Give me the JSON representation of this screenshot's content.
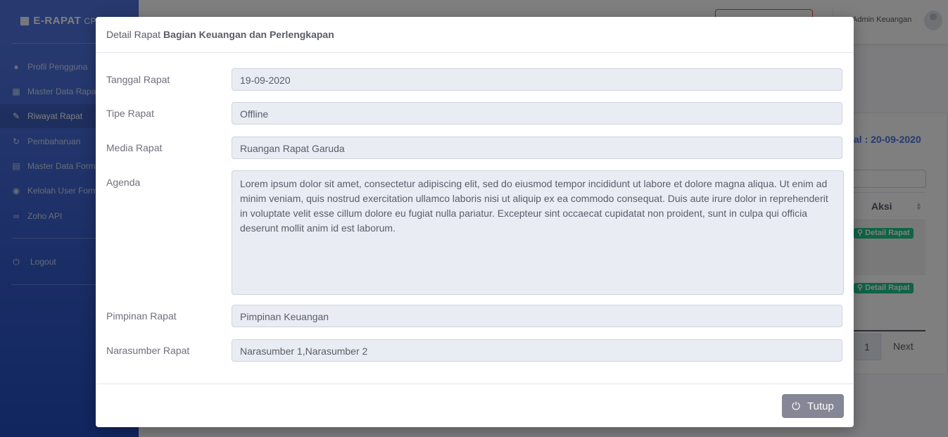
{
  "sidebar": {
    "brand_title": "E-RAPAT",
    "brand_sub": "CPA",
    "items": [
      {
        "label": "Profil Pengguna",
        "icon": "user-icon"
      },
      {
        "label": "Master Data Rapat",
        "icon": "calendar-icon"
      },
      {
        "label": "Riwayat Rapat",
        "icon": "edit-icon"
      },
      {
        "label": "Pembaharuan",
        "icon": "sync-icon"
      },
      {
        "label": "Master Data Form",
        "icon": "file-icon"
      },
      {
        "label": "Kelolah User Form",
        "icon": "user-circle-icon"
      },
      {
        "label": "Zoho API",
        "icon": "link-icon"
      }
    ],
    "logout_label": "Logout"
  },
  "topbar": {
    "user_name": "Admin Keuangan"
  },
  "background_card": {
    "date_text": "al : 20-09-2020",
    "column_header": "Aksi",
    "row_buttons": [
      "Detail Rapat",
      "Detail Rapat"
    ],
    "pagination": {
      "current_page": "1",
      "next_label": "Next"
    }
  },
  "modal": {
    "title_prefix": "Detail Rapat",
    "title_bold": "Bagian Keuangan dan Perlengkapan",
    "fields": {
      "tanggal": {
        "label": "Tanggal Rapat",
        "value": "19-09-2020"
      },
      "tipe": {
        "label": "Tipe Rapat",
        "value": "Offline"
      },
      "media": {
        "label": "Media Rapat",
        "value": "Ruangan Rapat Garuda"
      },
      "agenda": {
        "label": "Agenda",
        "value": "Lorem ipsum dolor sit amet, consectetur adipiscing elit, sed do eiusmod tempor incididunt ut labore et dolore magna aliqua. Ut enim ad minim veniam, quis nostrud exercitation ullamco laboris nisi ut aliquip ex ea commodo consequat. Duis aute irure dolor in reprehenderit in voluptate velit esse cillum dolore eu fugiat nulla pariatur. Excepteur sint occaecat cupidatat non proident, sunt in culpa qui officia deserunt mollit anim id est laborum."
      },
      "pimpinan": {
        "label": "Pimpinan Rapat",
        "value": "Pimpinan Keuangan"
      },
      "narasumber": {
        "label": "Narasumber Rapat",
        "value": "Narasumber 1,Narasumber 2"
      }
    },
    "close_label": "Tutup"
  },
  "colors": {
    "sidebar_top": "#4e73df",
    "sidebar_bottom": "#224abe",
    "success": "#1cc88a",
    "secondary": "#858796"
  }
}
